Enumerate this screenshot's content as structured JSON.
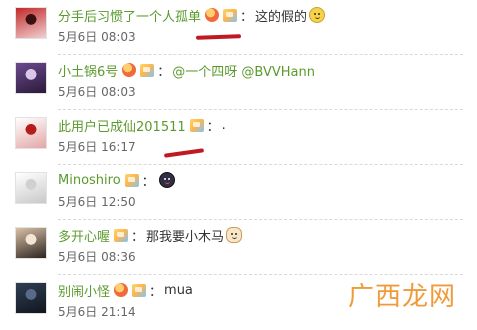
{
  "comments": [
    {
      "username": "分手后习惯了一个人孤单",
      "text": "这的假的",
      "time": "5月6日 08:03",
      "avatar_colors": [
        "#c22a2a",
        "#f0d0d0",
        "#3a1010"
      ],
      "has_heart": true,
      "emoji": "smile-icon"
    },
    {
      "username": "小土锅6号",
      "text": "@一个四呀 @BVVHann",
      "time": "5月6日 08:03",
      "avatar_colors": [
        "#6b4a8e",
        "#2b1a3a",
        "#d9c6e9"
      ],
      "has_heart": true,
      "emoji": ""
    },
    {
      "username": "此用户已成仙201511",
      "text": ".",
      "time": "5月6日 16:17",
      "avatar_colors": [
        "#ffffff",
        "#e3a6a6",
        "#b71c1c"
      ],
      "has_heart": false,
      "emoji": ""
    },
    {
      "username": "Minoshiro",
      "text": "",
      "time": "5月6日 12:50",
      "avatar_colors": [
        "#ffffff",
        "#c9c9c9",
        "#d0d0d0"
      ],
      "has_heart": false,
      "emoji": "cool-face-icon"
    },
    {
      "username": "多开心喔",
      "text": "那我要小木马",
      "time": "5月6日 08:36",
      "avatar_colors": [
        "#d9c1a6",
        "#2b2420",
        "#f4e4d2"
      ],
      "has_heart": false,
      "emoji": "dog-icon"
    },
    {
      "username": "别闹小怪",
      "text": "mua",
      "time": "5月6日 21:14",
      "avatar_colors": [
        "#2f3e54",
        "#11161f",
        "#586b86"
      ],
      "has_heart": true,
      "emoji": ""
    }
  ],
  "colon": "：",
  "watermark": "广西龙网",
  "colors": {
    "username": "#5a9a2d",
    "time": "#666666",
    "text": "#333333",
    "annotation_red": "#c0191f"
  }
}
